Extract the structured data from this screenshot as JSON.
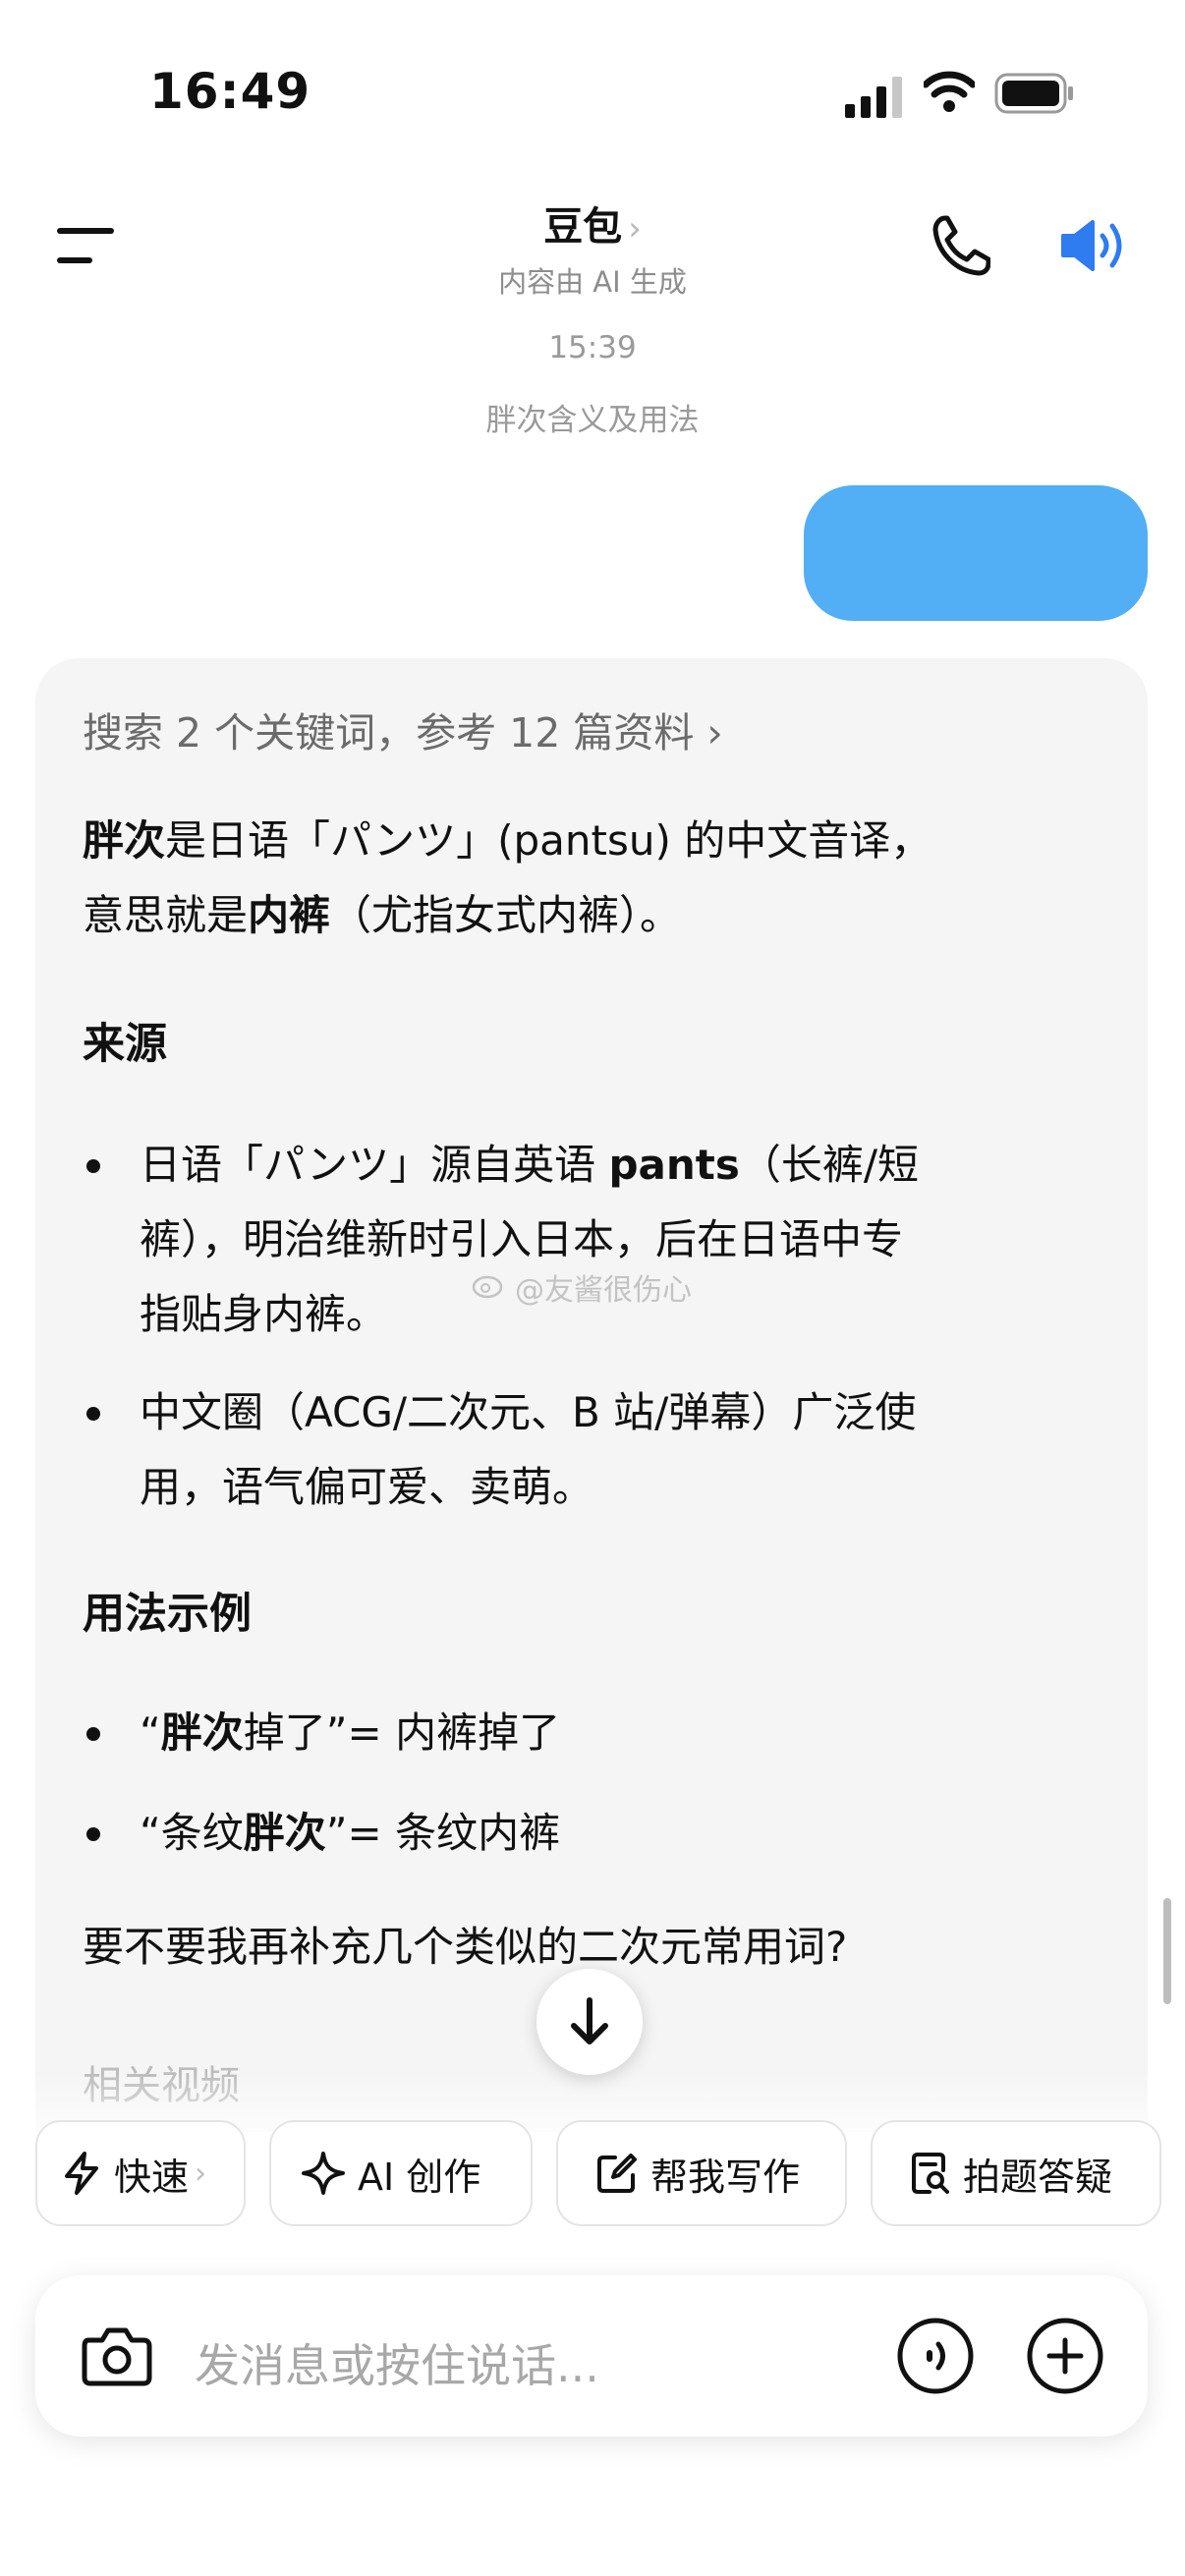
{
  "status_bar": {
    "time": "16:49"
  },
  "header": {
    "title": "豆包",
    "title_chevron": "›",
    "subtitle": "内容由 AI 生成"
  },
  "conversation": {
    "timestamp": "15:39",
    "topic": "胖次含义及用法"
  },
  "reply": {
    "search_ref": "搜索 2 个关键词，参考 12 篇资料 ›",
    "intro_line1_bold": "胖次",
    "intro_line1_rest": "是日语「パンツ」(pantsu) 的中文音译，",
    "intro_line2_pre": "意思就是",
    "intro_line2_bold": "内裤",
    "intro_line2_rest": "（尤指女式内裤）。",
    "section1_heading": "来源",
    "bullet1_line1_pre": "日语「パンツ」源自英语 ",
    "bullet1_line1_bold": "pants",
    "bullet1_line1_rest": "（长裤/短",
    "bullet1_line2": "裤），明治维新时引入日本，后在日语中专",
    "bullet1_line3": "指贴身内裤。",
    "bullet2_line1": "中文圈（ACG/二次元、B 站/弹幕）广泛使",
    "bullet2_line2": "用，语气偏可爱、卖萌。",
    "section2_heading": "用法示例",
    "example1_pre": "“",
    "example1_bold": "胖次",
    "example1_rest": "掉了”= 内裤掉了",
    "example2_pre": "“条纹",
    "example2_bold": "胖次",
    "example2_rest": "”= 条纹内裤",
    "follow_up": "要不要我再补充几个类似的二次元常用词?",
    "related_label": "相关视频"
  },
  "watermark": "@友酱很伤心",
  "chips": [
    {
      "label": "快速",
      "chevron": "›",
      "icon": "lightning-icon"
    },
    {
      "label": "AI 创作",
      "icon": "sparkle-icon"
    },
    {
      "label": "帮我写作",
      "icon": "edit-icon"
    },
    {
      "label": "拍题答疑",
      "icon": "search-doc-icon"
    }
  ],
  "input": {
    "placeholder": "发消息或按住说话..."
  },
  "colors": {
    "accent_blue": "#2f7bf0",
    "user_bubble": "#52aef5",
    "card_bg": "#f5f5f6"
  }
}
